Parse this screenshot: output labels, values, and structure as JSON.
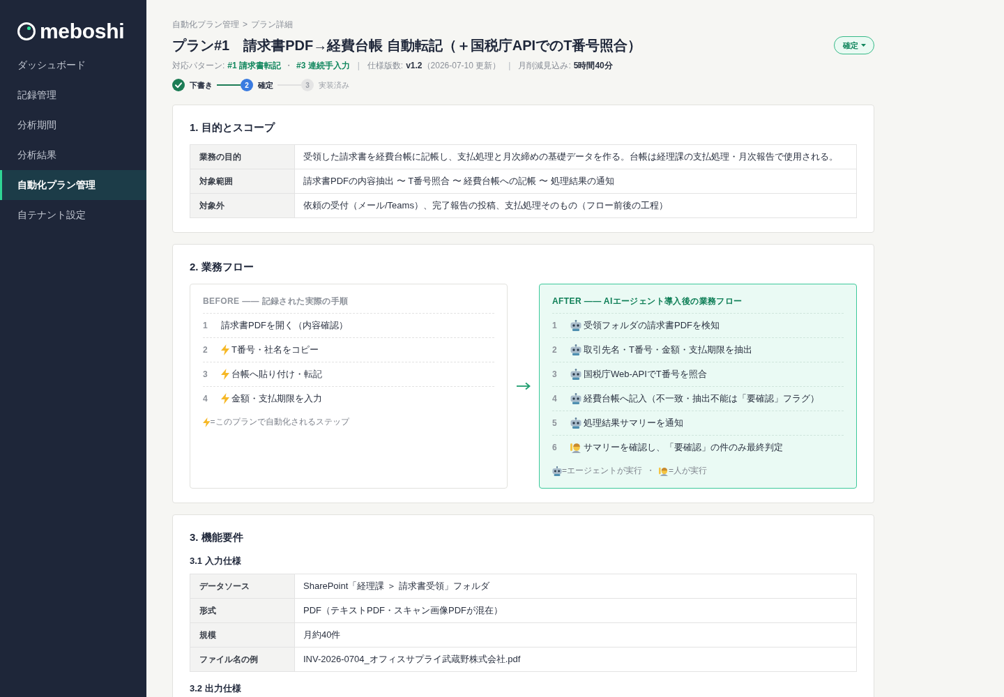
{
  "sidebar": {
    "logo": "meboshi",
    "items": [
      {
        "label": "ダッシュボード",
        "selected": false
      },
      {
        "label": "記録管理",
        "selected": false
      },
      {
        "label": "分析期間",
        "selected": false
      },
      {
        "label": "分析結果",
        "selected": false
      },
      {
        "label": "自動化プラン管理",
        "selected": true
      },
      {
        "label": "自テナント設定",
        "selected": false
      }
    ]
  },
  "breadcrumb": {
    "items": [
      "自動化プラン管理",
      "プラン詳細"
    ],
    "separator": ">"
  },
  "title": "プラン#1　請求書PDF→経費台帳 自動転記（＋国税庁APIでのT番号照合）",
  "status_button": {
    "label": "確定"
  },
  "meta": [
    {
      "kind": "label",
      "text": "対応パターン:"
    },
    {
      "kind": "link",
      "text": "#1 請求書転記"
    },
    {
      "kind": "dot",
      "text": "・"
    },
    {
      "kind": "link",
      "text": "#3 連続手入力"
    },
    {
      "kind": "divider",
      "text": "|"
    },
    {
      "kind": "label",
      "text": "仕様版数:"
    },
    {
      "kind": "value",
      "text": "v1.2"
    },
    {
      "kind": "note",
      "text": "（2026-07-10 更新）"
    },
    {
      "kind": "divider",
      "text": "|"
    },
    {
      "kind": "label",
      "text": "月削減見込み:"
    },
    {
      "kind": "value",
      "text": "5時間40分"
    }
  ],
  "stepper": [
    {
      "label": "下書き",
      "done": true,
      "selected": false
    },
    {
      "number": "2",
      "label": "確定",
      "done": false,
      "selected": true
    },
    {
      "number": "3",
      "label": "実装済み",
      "done": false,
      "selected": false
    }
  ],
  "sections": [
    {
      "title": "1. 目的とスコープ",
      "blocks": [
        {
          "kind": "table",
          "rows": [
            {
              "label": "業務の目的",
              "value": "受領した請求書を経費台帳に記帳し、支払処理と月次締めの基礎データを作る。台帳は経理課の支払処理・月次報告で使用される。"
            },
            {
              "label": "対象範囲",
              "value": "請求書PDFの内容抽出 〜 T番号照合 〜 経費台帳への記帳 〜 処理結果の通知"
            },
            {
              "label": "対象外",
              "value": "依頼の受付（メール/Teams）、完了報告の投稿、支払処理そのもの（フロー前後の工程）"
            }
          ]
        }
      ]
    },
    {
      "title": "2. 業務フロー",
      "blocks": [
        {
          "kind": "flow",
          "panels": [
            {
              "kind": "before",
              "heading": "BEFORE —— 記録された実際の手順",
              "steps": [
                {
                  "number": "1",
                  "text": "請求書PDFを開く（内容確認）",
                  "automated": false
                },
                {
                  "number": "2",
                  "text": "T番号・社名をコピー",
                  "automated": true
                },
                {
                  "number": "3",
                  "text": "台帳へ貼り付け・転記",
                  "automated": true
                },
                {
                  "number": "4",
                  "text": "金額・支払期限を入力",
                  "automated": true
                }
              ],
              "legend": {
                "items": [
                  {
                    "kind": "automated",
                    "text": "=このプランで自動化されるステップ"
                  }
                ]
              }
            },
            {
              "kind": "after",
              "heading": "AFTER —— AIエージェント導入後の業務フロー",
              "steps": [
                {
                  "number": "1",
                  "text": "受領フォルダの請求書PDFを検知",
                  "kind": "agent"
                },
                {
                  "number": "2",
                  "text": "取引先名・T番号・金額・支払期限を抽出",
                  "kind": "agent"
                },
                {
                  "number": "3",
                  "text": "国税庁Web-APIでT番号を照合",
                  "kind": "agent"
                },
                {
                  "number": "4",
                  "text": "経費台帳へ記入（不一致・抽出不能は「要確認」フラグ）",
                  "kind": "agent"
                },
                {
                  "number": "5",
                  "text": "処理結果サマリーを通知",
                  "kind": "agent"
                },
                {
                  "number": "6",
                  "text": "サマリーを確認し、「要確認」の件のみ最終判定",
                  "kind": "human"
                }
              ],
              "legend": {
                "items": [
                  {
                    "kind": "agent",
                    "text": "=エージェントが実行"
                  },
                  {
                    "kind": "human",
                    "text": "=人が実行"
                  }
                ],
                "separator": "・"
              }
            }
          ]
        }
      ]
    },
    {
      "title": "3. 機能要件",
      "blocks": [
        {
          "kind": "subheading",
          "text": "3.1 入力仕様"
        },
        {
          "kind": "table",
          "rows": [
            {
              "label": "データソース",
              "value": "SharePoint「経理課 ＞ 請求書受領」フォルダ"
            },
            {
              "label": "形式",
              "value": "PDF（テキストPDF・スキャン画像PDFが混在）"
            },
            {
              "label": "規模",
              "value": "月約40件"
            },
            {
              "label": "ファイル名の例",
              "value": "INV-2026-0704_オフィスサプライ武蔵野株式会社.pdf"
            }
          ]
        },
        {
          "kind": "subheading",
          "text": "3.2 出力仕様"
        }
      ]
    }
  ]
}
